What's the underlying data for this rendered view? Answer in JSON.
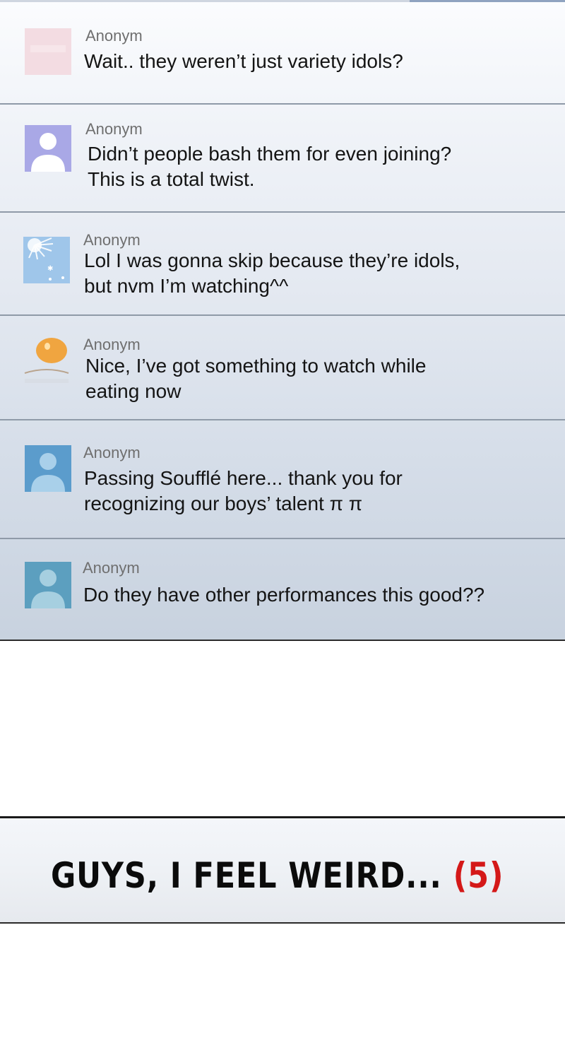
{
  "comments": [
    {
      "author": "Anonym",
      "lines": [
        "Wait.. they weren’t just variety idols?"
      ],
      "avatar_icon": "pink-blank-avatar-icon"
    },
    {
      "author": "Anonym",
      "lines": [
        "Didn’t people bash them for even joining?",
        "This is a total twist."
      ],
      "avatar_icon": "default-user-avatar-icon"
    },
    {
      "author": "Anonym",
      "lines": [
        "Lol I was gonna skip because they’re idols,",
        "but nvm I’m watching^^"
      ],
      "avatar_icon": "sun-rays-avatar-icon"
    },
    {
      "author": "Anonym",
      "lines": [
        "Nice, I’ve got something to watch while",
        "eating now"
      ],
      "avatar_icon": "egg-yolk-avatar-icon"
    },
    {
      "author": "Anonym",
      "lines": [
        "Passing Soufflé here... thank you for",
        "recognizing our boys’ talent π π"
      ],
      "avatar_icon": "default-user-avatar-icon"
    },
    {
      "author": "Anonym",
      "lines": [
        "Do they have other performances this good??"
      ],
      "avatar_icon": "default-user-avatar-icon"
    }
  ],
  "title": {
    "text": "GUYS, I FEEL WEIRD...",
    "count": "(5)"
  },
  "colors": {
    "count_red": "#d41818",
    "avatar_purple": "#a9a8e6",
    "avatar_blue": "#5b9ccc",
    "avatar_teal": "#5c9fbf"
  }
}
